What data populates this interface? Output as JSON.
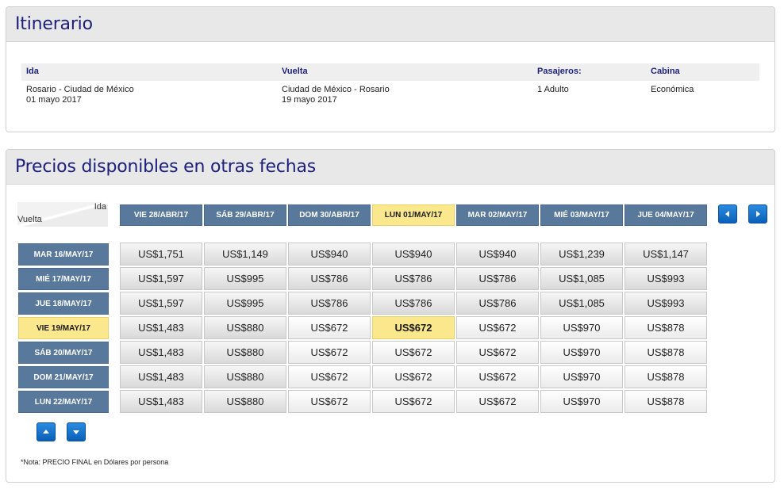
{
  "itinerary": {
    "title": "Itinerario",
    "columns": {
      "ida": "Ida",
      "vuelta": "Vuelta",
      "pasajeros": "Pasajeros:",
      "cabina": "Cabina"
    },
    "ida_route": "Rosario - Ciudad de México",
    "ida_date": "01 mayo 2017",
    "vuelta_route": "Ciudad de México - Rosario",
    "vuelta_date": "19 mayo 2017",
    "pasajeros_value": "1 Adulto",
    "cabina_value": "Económica"
  },
  "prices": {
    "title": "Precios disponibles en otras fechas",
    "corner_ida": "Ida",
    "corner_vuelta": "Vuelta",
    "departure_dates": [
      "VIE 28/ABR/17",
      "SÁB 29/ABR/17",
      "DOM 30/ABR/17",
      "LUN 01/MAY/17",
      "MAR 02/MAY/17",
      "MIÉ 03/MAY/17",
      "JUE 04/MAY/17"
    ],
    "return_dates": [
      "MAR 16/MAY/17",
      "MIÉ 17/MAY/17",
      "JUE 18/MAY/17",
      "VIE 19/MAY/17",
      "SÁB 20/MAY/17",
      "DOM 21/MAY/17",
      "LUN 22/MAY/17"
    ],
    "selected_departure_index": 3,
    "selected_return_index": 3,
    "grid": [
      [
        "US$1,751",
        "US$1,149",
        "US$940",
        "US$940",
        "US$940",
        "US$1,239",
        "US$1,147"
      ],
      [
        "US$1,597",
        "US$995",
        "US$786",
        "US$786",
        "US$786",
        "US$1,085",
        "US$993"
      ],
      [
        "US$1,597",
        "US$995",
        "US$786",
        "US$786",
        "US$786",
        "US$1,085",
        "US$993"
      ],
      [
        "US$1,483",
        "US$880",
        "US$672",
        "US$672",
        "US$672",
        "US$970",
        "US$878"
      ],
      [
        "US$1,483",
        "US$880",
        "US$672",
        "US$672",
        "US$672",
        "US$970",
        "US$878"
      ],
      [
        "US$1,483",
        "US$880",
        "US$672",
        "US$672",
        "US$672",
        "US$970",
        "US$878"
      ],
      [
        "US$1,483",
        "US$880",
        "US$672",
        "US$672",
        "US$672",
        "US$970",
        "US$878"
      ]
    ],
    "note": "*Nota: PRECIO FINAL en Dólares por persona",
    "icons": {
      "prev": "arrow-left-icon",
      "next": "arrow-right-icon",
      "up": "arrow-up-icon",
      "down": "arrow-down-icon"
    },
    "colors": {
      "header_blue": "#58789c",
      "selected_yellow": "#fbe78c",
      "title_navy": "#1d1f7a",
      "button_blue": "#1a76d2"
    }
  }
}
